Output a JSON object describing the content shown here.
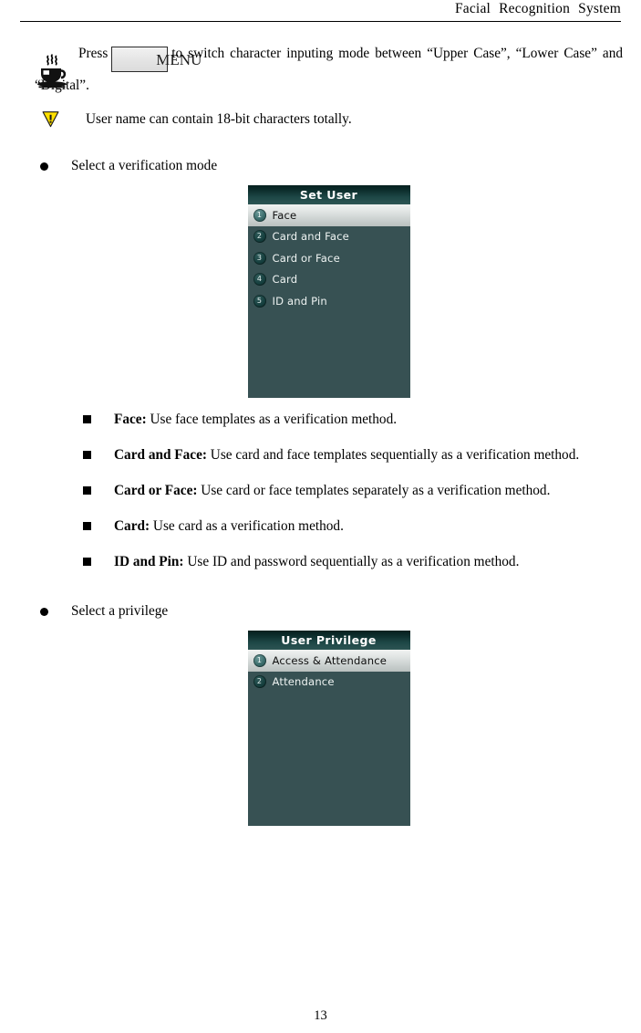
{
  "header": {
    "title": "Facial  Recognition  System"
  },
  "tip": {
    "icon": "coffee-cup-icon",
    "text_before": "Press",
    "menu_key_label": "MENU",
    "text_after": "to switch character inputing mode between “Upper Case”, “Lower Case” and “Digital”."
  },
  "note": {
    "icon": "warning-triangle-icon",
    "text": "User name can contain 18-bit characters totally."
  },
  "sections": [
    {
      "heading": "Select a verification mode",
      "screen": {
        "title": "Set User",
        "items": [
          {
            "number": "1",
            "label": "Face",
            "selected": true
          },
          {
            "number": "2",
            "label": "Card and Face",
            "selected": false
          },
          {
            "number": "3",
            "label": "Card or Face",
            "selected": false
          },
          {
            "number": "4",
            "label": "Card",
            "selected": false
          },
          {
            "number": "5",
            "label": "ID and Pin",
            "selected": false
          }
        ]
      },
      "descriptions": [
        {
          "term": "Face:",
          "text": " Use face templates as a verification method."
        },
        {
          "term": "Card and Face:",
          "text": " Use card and face templates sequentially as a verification method."
        },
        {
          "term": "Card or Face:",
          "text": " Use card or face templates separately as a verification method."
        },
        {
          "term": "Card:",
          "text": " Use card as a verification method."
        },
        {
          "term": "ID and Pin:",
          "text": " Use ID and password sequentially as a verification method."
        }
      ]
    },
    {
      "heading": "Select a privilege",
      "screen": {
        "title": "User Privilege",
        "items": [
          {
            "number": "1",
            "label": "Access & Attendance",
            "selected": true
          },
          {
            "number": "2",
            "label": "Attendance",
            "selected": false
          }
        ]
      },
      "descriptions": []
    }
  ],
  "footer": {
    "page_number": "13"
  },
  "colors": {
    "screen_background": "#375153",
    "screen_title_dark": "#06201f",
    "screen_title_teal": "#2c5453",
    "selected_row_light": "#f0f2f1",
    "warning_yellow": "#ffe000",
    "text_black": "#000000"
  }
}
